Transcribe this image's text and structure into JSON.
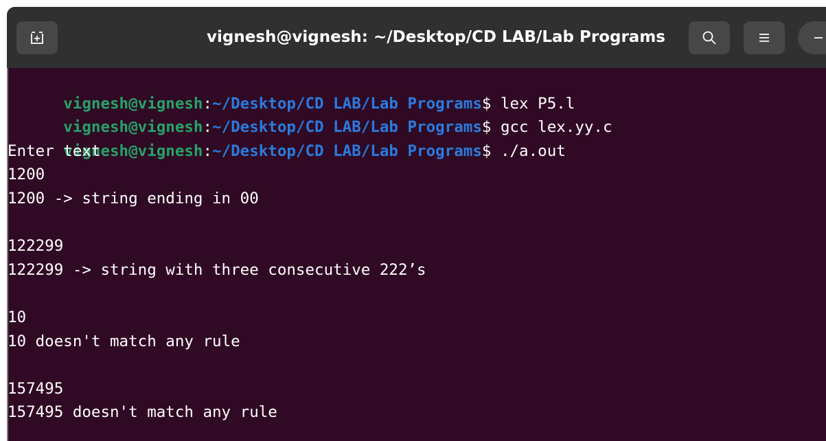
{
  "window": {
    "title": "vignesh@vignesh: ~/Desktop/CD LAB/Lab Programs"
  },
  "titlebar_buttons": {
    "new_tab_icon": "new-tab-icon",
    "search_icon": "search-icon",
    "menu_icon": "hamburger-menu-icon",
    "minimize_icon": "minimize-icon"
  },
  "prompt": {
    "user": "vignesh@vignesh",
    "colon": ":",
    "path": "~/Desktop/CD LAB/Lab Programs",
    "dollar": "$"
  },
  "commands": [
    " lex P5.l",
    " gcc lex.yy.c",
    " ./a.out"
  ],
  "output": [
    "Enter text",
    "1200",
    "1200 -> string ending in 00",
    "",
    "122299",
    "122299 -> string with three consecutive 222’s",
    "",
    "10",
    "10 doesn't match any rule",
    "",
    "157495",
    "157495 doesn't match any rule"
  ],
  "colors": {
    "background": "#300a24",
    "titlebar": "#303030",
    "user": "#26a269",
    "path": "#2a7bde",
    "text": "#ffffff"
  }
}
